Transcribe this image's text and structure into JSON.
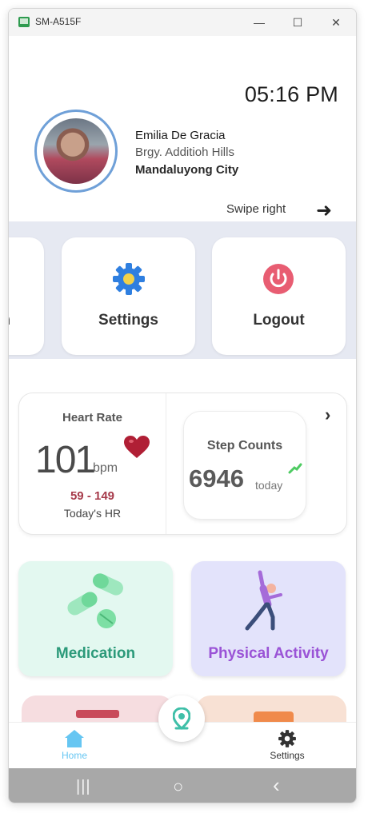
{
  "window": {
    "title": "SM-A515F",
    "minimize": "—",
    "maximize": "☐",
    "close": "✕"
  },
  "header": {
    "time": "05:16 PM"
  },
  "profile": {
    "name": "Emilia De Gracia",
    "address": "Brgy. Additioh Hills",
    "city": "Mandaluyong City"
  },
  "swipe": {
    "label": "Swipe right",
    "arrow": "➜"
  },
  "menu": {
    "partial_label": "n",
    "settings_label": "Settings",
    "logout_label": "Logout",
    "settings_icon": "gear-icon",
    "logout_icon": "power-icon"
  },
  "heart_rate": {
    "title": "Heart Rate",
    "value": "101",
    "unit": "bpm",
    "range": "59 - 149",
    "caption": "Today's HR"
  },
  "steps": {
    "title": "Step Counts",
    "value": "6946",
    "unit": "today"
  },
  "chevron": "›",
  "cards": {
    "medication": "Medication",
    "physical_activity": "Physical Activity"
  },
  "bottom_nav": {
    "home_label": "Home",
    "settings_label": "Settings"
  },
  "sys_nav": {
    "recents": "|||",
    "home": "○",
    "back": "‹"
  },
  "colors": {
    "accent_blue": "#6fa0d8",
    "medication_bg": "#e3f8f0",
    "medication_text": "#2c9a7a",
    "activity_bg": "#e3e3fb",
    "activity_text": "#9a53d6",
    "heart_red": "#a63a4a"
  }
}
